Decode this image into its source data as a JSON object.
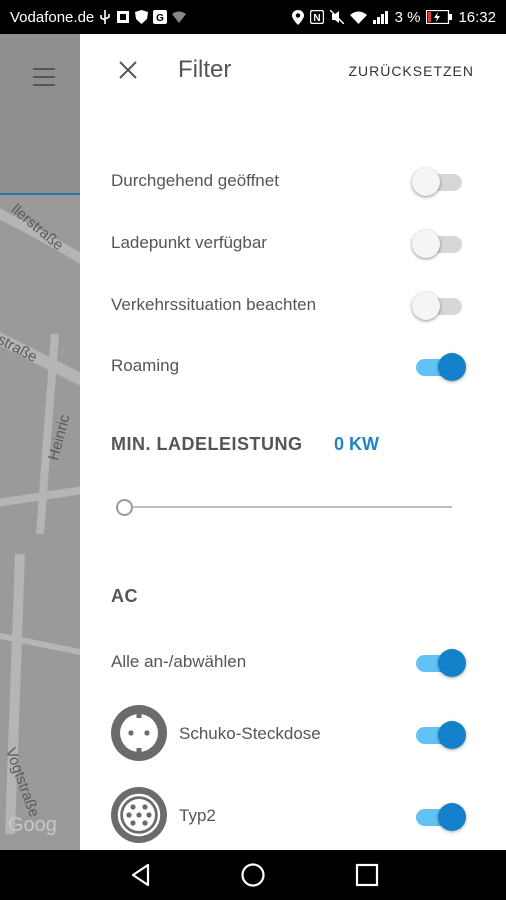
{
  "status_bar": {
    "carrier": "Vodafone.de",
    "battery_percent": "3 %",
    "time": "16:32"
  },
  "map": {
    "streets": [
      "llerstraße",
      "straße",
      "Heinric",
      "Vogtstraße"
    ],
    "watermark": "Goog"
  },
  "filter": {
    "title": "Filter",
    "reset_label": "ZURÜCKSETZEN",
    "toggles": [
      {
        "label": "Durchgehend geöffnet",
        "on": false
      },
      {
        "label": "Ladepunkt verfügbar",
        "on": false
      },
      {
        "label": "Verkehrssituation beachten",
        "on": false
      },
      {
        "label": "Roaming",
        "on": true
      }
    ],
    "min_power": {
      "heading": "MIN. LADELEISTUNG",
      "value": "0 KW",
      "slider_value": 0
    },
    "ac": {
      "heading": "AC",
      "select_all": {
        "label": "Alle an-/abwählen",
        "on": true
      },
      "plugs": [
        {
          "label": "Schuko-Steckdose",
          "on": true,
          "icon": "schuko-plug-icon"
        },
        {
          "label": "Typ2",
          "on": true,
          "icon": "type2-plug-icon"
        }
      ]
    }
  },
  "colors": {
    "accent": "#1381c9",
    "toggle_track_on": "#62c2f4",
    "kw_value": "#1e86c8"
  }
}
